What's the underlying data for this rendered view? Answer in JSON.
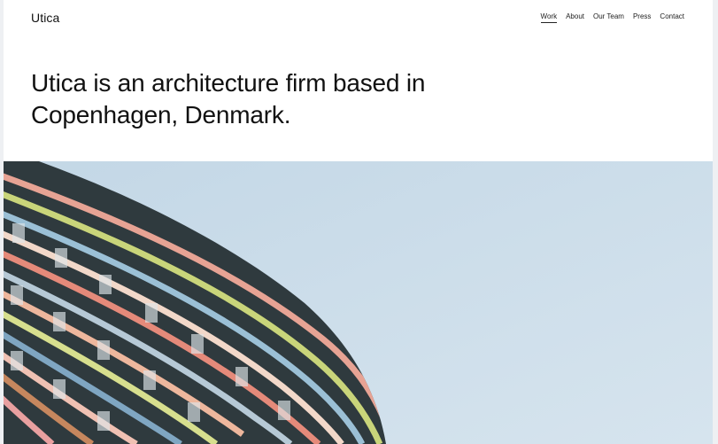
{
  "site": {
    "title": "Utica"
  },
  "nav": {
    "items": [
      {
        "label": "Work",
        "active": true
      },
      {
        "label": "About",
        "active": false
      },
      {
        "label": "Our Team",
        "active": false
      },
      {
        "label": "Press",
        "active": false
      },
      {
        "label": "Contact",
        "active": false
      }
    ]
  },
  "hero": {
    "heading": "Utica is an architecture firm based in Copenhagen, Denmark."
  },
  "image": {
    "subject": "curved-colorful-building-facade",
    "sky_color": "#c9dce9"
  }
}
